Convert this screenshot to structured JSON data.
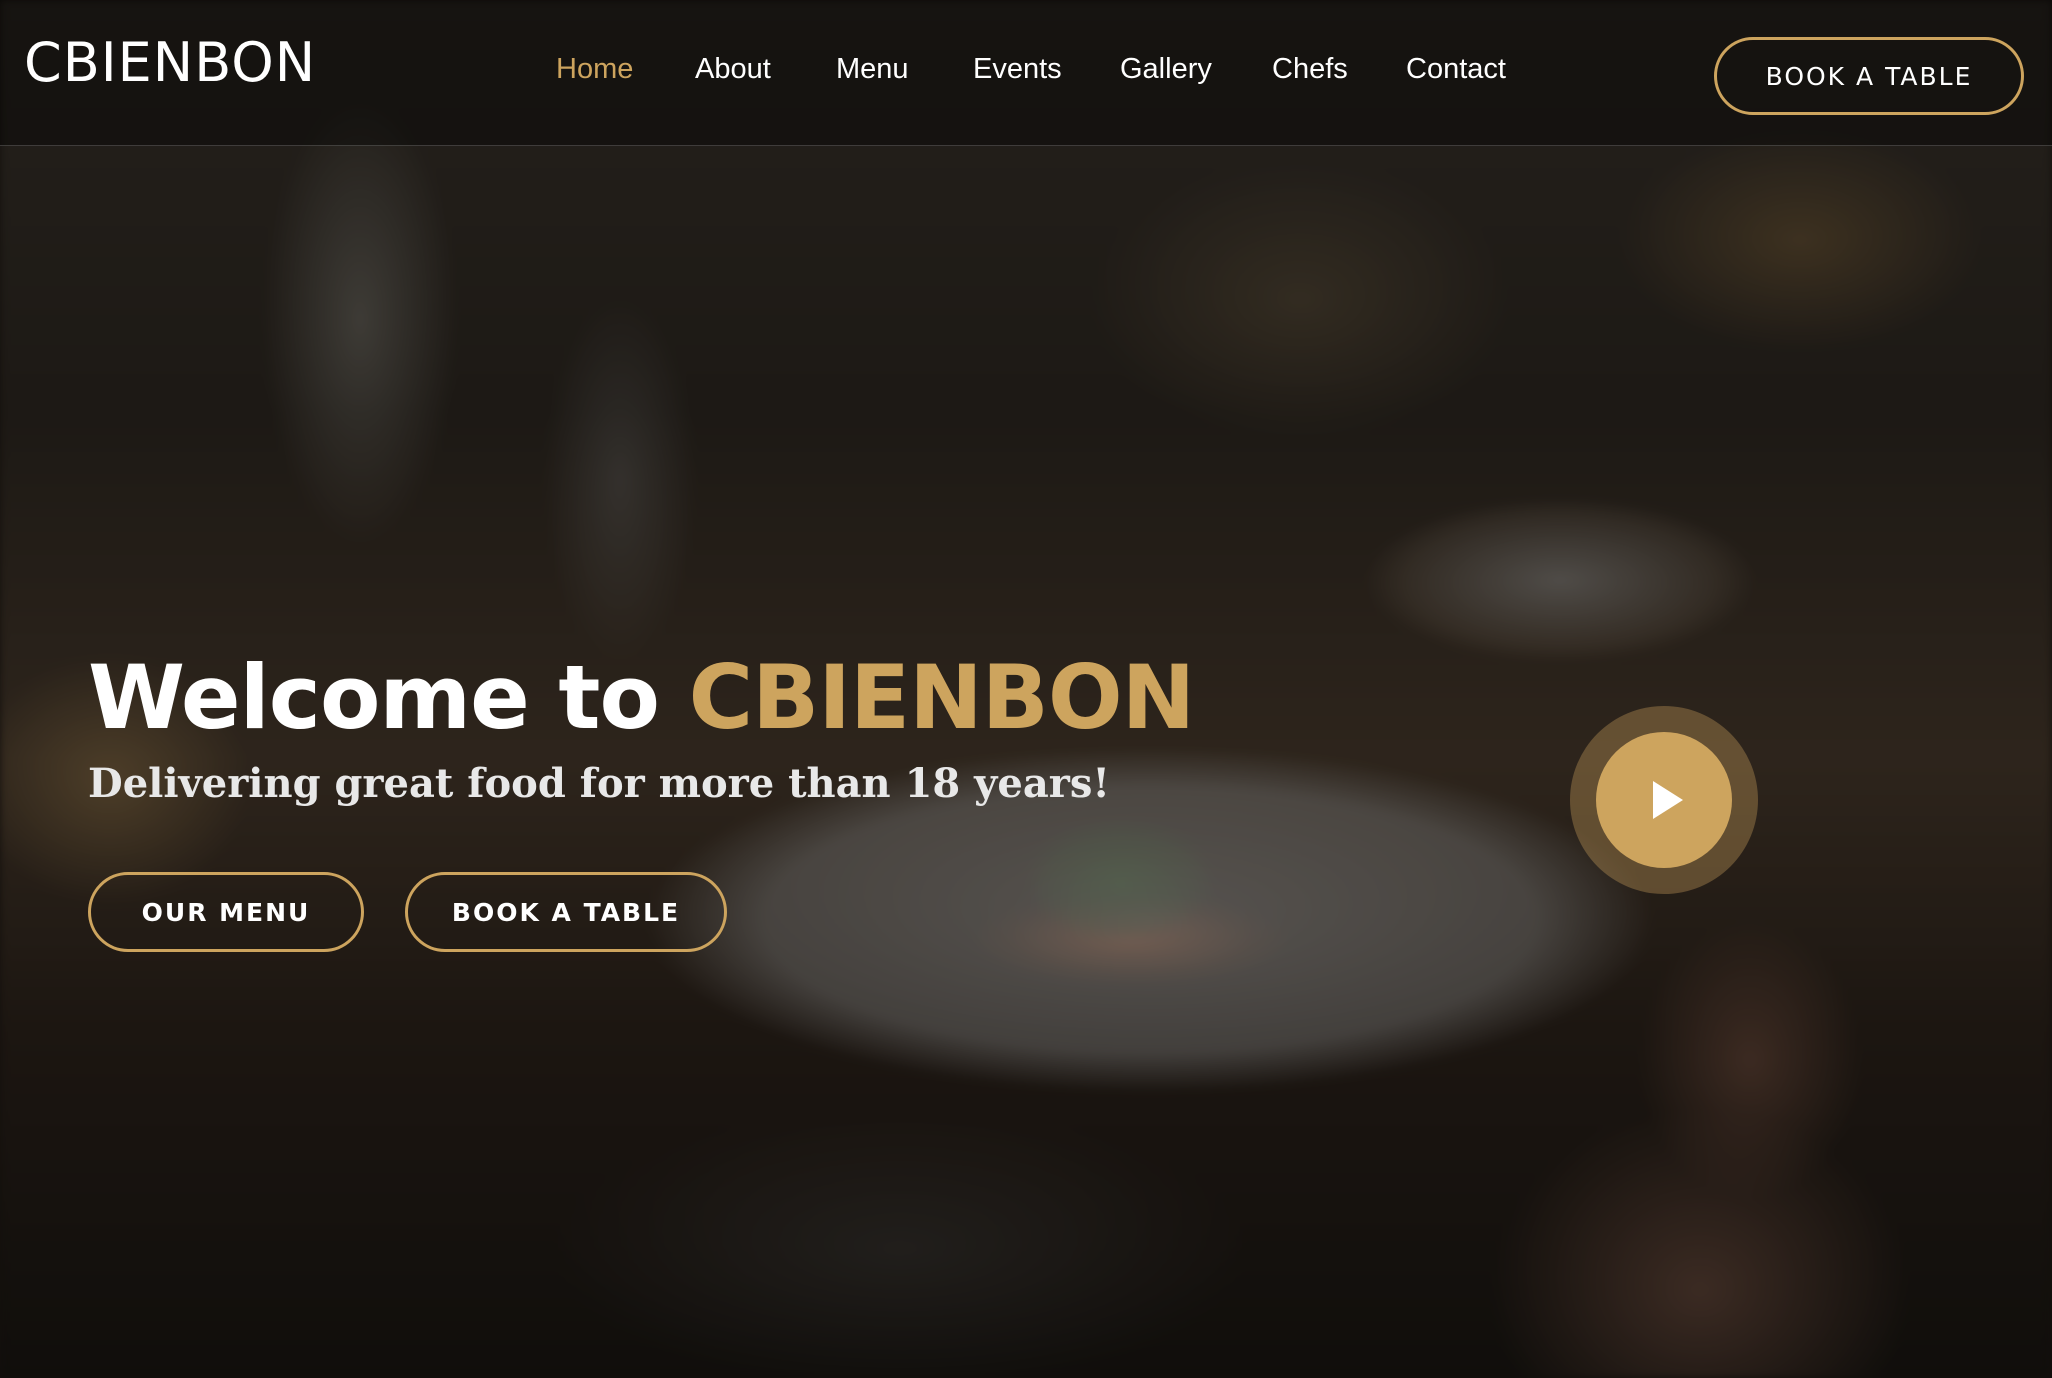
{
  "brand": {
    "name": "CBIENBON"
  },
  "nav": {
    "items": [
      {
        "label": "Home",
        "active": true
      },
      {
        "label": "About",
        "active": false
      },
      {
        "label": "Menu",
        "active": false
      },
      {
        "label": "Events",
        "active": false
      },
      {
        "label": "Gallery",
        "active": false
      },
      {
        "label": "Chefs",
        "active": false
      },
      {
        "label": "Contact",
        "active": false
      }
    ],
    "cta_label": "BOOK A TABLE"
  },
  "hero": {
    "title_prefix": "Welcome to ",
    "title_highlight": "CBIENBON",
    "subtitle": "Delivering great food for more than 18 years!",
    "buttons": {
      "menu_label": "OUR MENU",
      "book_label": "BOOK A TABLE"
    },
    "play_icon": "play-icon"
  },
  "colors": {
    "accent": "#cda45e",
    "text": "#ffffff",
    "header_bg": "rgba(0,0,0,0.38)"
  }
}
